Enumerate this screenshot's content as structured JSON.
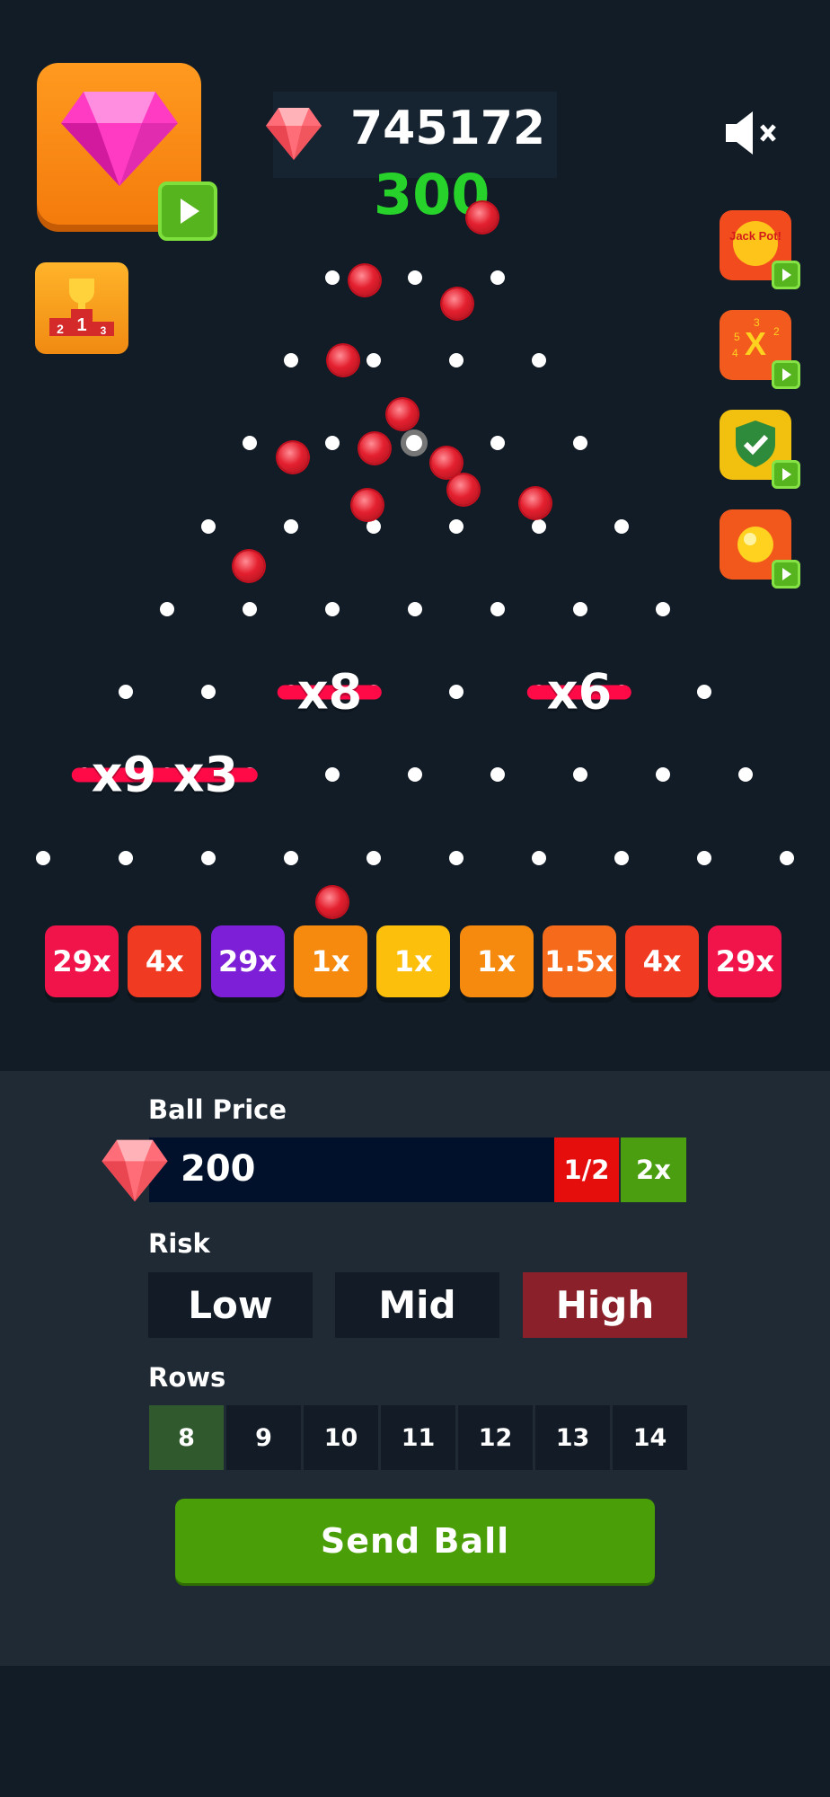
{
  "header": {
    "score": "745172",
    "win_amount": "300",
    "gem_button_icon": "pink-diamond-icon",
    "play_icon": "play-icon",
    "trophy_icon": "trophy-podium-icon",
    "mute_icon": "speaker-muted-icon",
    "currency_icon": "ruby-gem-icon"
  },
  "side_buttons": [
    {
      "name": "jackpot-button",
      "icon": "jackpot-icon",
      "label": "Jack Pot!",
      "color": "#f24b1e"
    },
    {
      "name": "multiplier-button",
      "icon": "multiplier-x-icon",
      "label": "X",
      "color": "#f25a1e"
    },
    {
      "name": "shield-button",
      "icon": "shield-check-icon",
      "color": "#f2c00e"
    },
    {
      "name": "sun-ball-button",
      "icon": "golden-ball-icon",
      "color": "#f2581c"
    }
  ],
  "board": {
    "peg_multipliers": [
      "x8",
      "x6",
      "x9",
      "x3"
    ],
    "buckets": [
      {
        "label": "29x",
        "color": "#f0144a"
      },
      {
        "label": "4x",
        "color": "#f03a22"
      },
      {
        "label": "29x",
        "color": "#7d1fd6"
      },
      {
        "label": "1x",
        "color": "#f58a0f"
      },
      {
        "label": "1x",
        "color": "#fcbf0c"
      },
      {
        "label": "1x",
        "color": "#f58a0f"
      },
      {
        "label": "1.5x",
        "color": "#f66b1b"
      },
      {
        "label": "4x",
        "color": "#f03a22"
      },
      {
        "label": "29x",
        "color": "#f0144a"
      }
    ]
  },
  "controls": {
    "ball_price_label": "Ball Price",
    "ball_price": "200",
    "half_label": "1/2",
    "double_label": "2x",
    "risk_label": "Risk",
    "risk_options": [
      "Low",
      "Mid",
      "High"
    ],
    "risk_selected": "High",
    "rows_label": "Rows",
    "rows_options": [
      "8",
      "9",
      "10",
      "11",
      "12",
      "13",
      "14"
    ],
    "rows_selected": "8",
    "send_label": "Send Ball"
  }
}
